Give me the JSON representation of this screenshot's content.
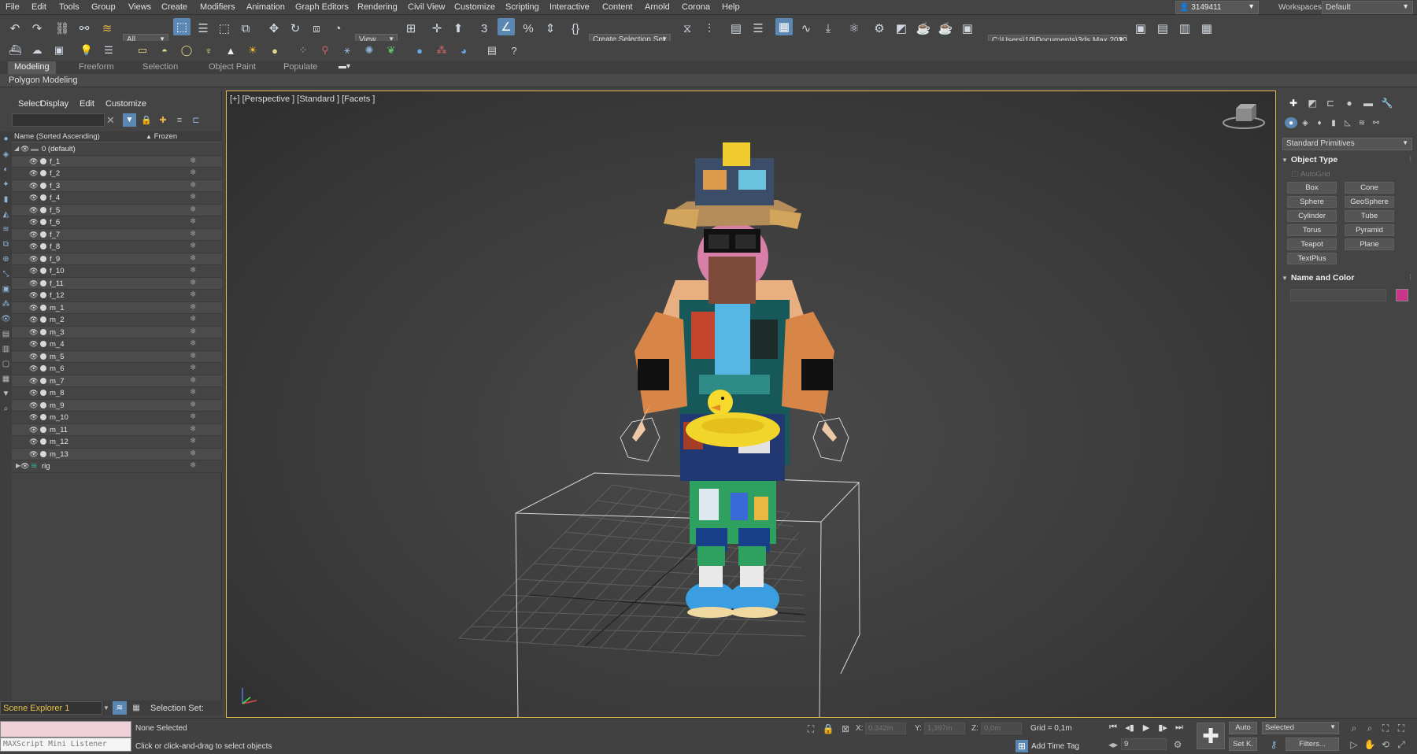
{
  "menubar": {
    "items": [
      "File",
      "Edit",
      "Tools",
      "Group",
      "Views",
      "Create",
      "Modifiers",
      "Animation",
      "Graph Editors",
      "Rendering",
      "Civil View",
      "Customize",
      "Scripting",
      "Interactive",
      "Content",
      "Arnold",
      "Corona",
      "Help"
    ],
    "account": "3149411",
    "workspaces_label": "Workspaces:",
    "workspace": "Default"
  },
  "toolbar": {
    "selection_filter": "All",
    "ref_coord": "View",
    "named_selection": "Create Selection Set",
    "project_path": "C:\\Users\\10\\Documents\\3ds Max 2020"
  },
  "ribbon": {
    "tabs": [
      "Modeling",
      "Freeform",
      "Selection",
      "Object Paint",
      "Populate"
    ],
    "active_tab": "Modeling",
    "panel": "Polygon Modeling"
  },
  "explorer": {
    "menu": [
      "Select",
      "Display",
      "Edit",
      "Customize"
    ],
    "col_name": "Name (Sorted Ascending)",
    "col_frozen": "Frozen",
    "root_layer": "0 (default)",
    "objects": [
      "f_1",
      "f_2",
      "f_3",
      "f_4",
      "f_5",
      "f_6",
      "f_7",
      "f_8",
      "f_9",
      "f_10",
      "f_11",
      "f_12",
      "m_1",
      "m_2",
      "m_3",
      "m_4",
      "m_5",
      "m_6",
      "m_7",
      "m_8",
      "m_9",
      "m_10",
      "m_11",
      "m_12",
      "m_13"
    ],
    "rig_layer": "rig",
    "footer_name": "Scene Explorer 1",
    "selection_set_label": "Selection Set:"
  },
  "viewport": {
    "label": "[+] [Perspective ] [Standard ] [Facets ]",
    "border_color": "#e2c14a"
  },
  "command_panel": {
    "category": "Standard Primitives",
    "object_type_title": "Object Type",
    "autogrid": "AutoGrid",
    "buttons": [
      "Box",
      "Cone",
      "Sphere",
      "GeoSphere",
      "Cylinder",
      "Tube",
      "Torus",
      "Pyramid",
      "Teapot",
      "Plane",
      "TextPlus"
    ],
    "name_color_title": "Name and Color",
    "swatch_color": "#c8358a"
  },
  "status": {
    "listener": "MAXScript Mini Listener",
    "selection": "None Selected",
    "prompt": "Click or click-and-drag to select objects",
    "x_label": "X:",
    "x_value": "0,342m",
    "y_label": "Y:",
    "y_value": "1,397m",
    "z_label": "Z:",
    "z_value": "0,0m",
    "grid": "Grid = 0,1m",
    "add_time_tag": "Add Time Tag",
    "auto_key": "Auto",
    "set_key": "Set K.",
    "key_filter": "Selected",
    "filters": "Filters...",
    "frame": "9"
  }
}
